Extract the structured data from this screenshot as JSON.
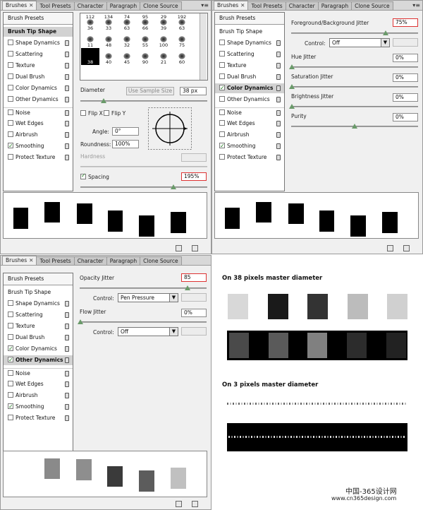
{
  "tabs": {
    "brushes": "Brushes",
    "tool_presets": "Tool Presets",
    "character": "Character",
    "paragraph": "Paragraph",
    "clone_source": "Clone Source",
    "close": "✕"
  },
  "sidebar": {
    "brush_presets": "Brush Presets",
    "brush_tip_shape": "Brush Tip Shape",
    "shape_dynamics": "Shape Dynamics",
    "scattering": "Scattering",
    "texture": "Texture",
    "dual_brush": "Dual Brush",
    "color_dynamics": "Color Dynamics",
    "other_dynamics": "Other Dynamics",
    "noise": "Noise",
    "wet_edges": "Wet Edges",
    "airbrush": "Airbrush",
    "smoothing": "Smoothing",
    "protect_texture": "Protect Texture"
  },
  "p1": {
    "tips": [
      [
        "112",
        "36"
      ],
      [
        "134",
        "33"
      ],
      [
        "74",
        "63"
      ],
      [
        "95",
        "66"
      ],
      [
        "29",
        "39"
      ],
      [
        "192",
        "63"
      ],
      [
        "",
        "11"
      ],
      [
        "",
        "48"
      ],
      [
        "",
        "32"
      ],
      [
        "",
        "55"
      ],
      [
        "",
        "100"
      ],
      [
        "",
        "75"
      ],
      [
        "",
        "38"
      ],
      [
        "",
        "40"
      ],
      [
        "",
        "45"
      ],
      [
        "",
        "90"
      ],
      [
        "",
        "21"
      ],
      [
        "",
        "60"
      ]
    ],
    "diameter_label": "Diameter",
    "use_sample_size": "Use Sample Size",
    "diameter_value": "38 px",
    "flip_x": "Flip X",
    "flip_y": "Flip Y",
    "angle_label": "Angle:",
    "angle_value": "0°",
    "roundness_label": "Roundness:",
    "roundness_value": "100%",
    "hardness_label": "Hardness",
    "spacing_label": "Spacing",
    "spacing_value": "195%"
  },
  "p2": {
    "fg_bg_label": "Foreground/Background Jitter",
    "fg_bg_value": "75%",
    "control_label": "Control:",
    "control_value": "Off",
    "hue_label": "Hue Jitter",
    "hue_value": "0%",
    "sat_label": "Saturation Jitter",
    "sat_value": "0%",
    "bright_label": "Brightness Jitter",
    "bright_value": "0%",
    "purity_label": "Purity",
    "purity_value": "0%"
  },
  "p3": {
    "opacity_label": "Opacity Jitter",
    "opacity_value": "85",
    "control_label": "Control:",
    "control1_value": "Pen Pressure",
    "flow_label": "Flow Jitter",
    "flow_value": "0%",
    "control2_value": "Off"
  },
  "demo": {
    "title1": "On 38 pixels master diameter",
    "title2": "On 3 pixels master diameter"
  },
  "watermark": {
    "line1": "中国-365设计网",
    "line2": "www.cn365design.com"
  }
}
